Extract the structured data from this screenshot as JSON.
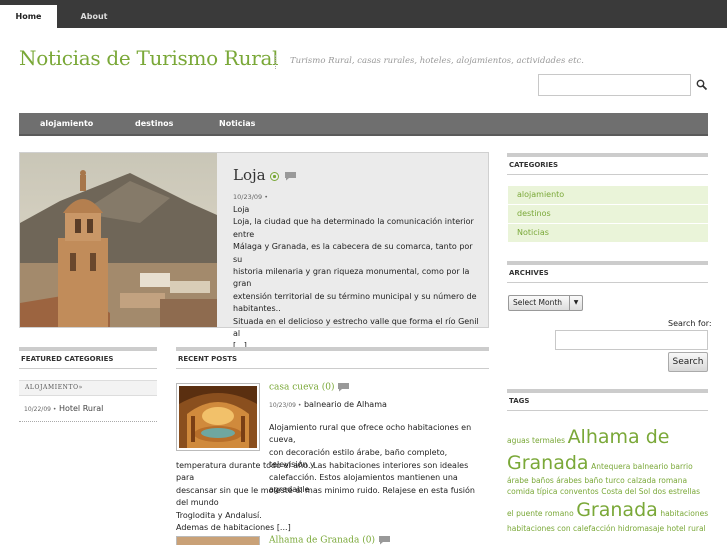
{
  "topnav": {
    "tabs": [
      {
        "label": "Home",
        "active": true
      },
      {
        "label": "About",
        "active": false
      }
    ]
  },
  "header": {
    "title": "Noticias de Turismo Rural",
    "tagline": "Turismo Rural, casas rurales, hoteles, alojamientos, actividades etc.",
    "search_icon": "magnifier-icon"
  },
  "mainnav": {
    "items": [
      "alojamiento",
      "destinos",
      "Noticias"
    ]
  },
  "featured_post": {
    "title": "Loja",
    "date": "10/23/09 •",
    "lines": [
      "Loja",
      "Loja, la ciudad que ha determinado la comunicación interior entre",
      "Málaga y Granada, es la cabecera de su comarca, tanto por su",
      "historia milenaria y gran riqueza monumental, como por la gran",
      "extensión territorial de su término municipal y su número de",
      "habitantes..",
      "Situada en el delicioso y estrecho valle que forma el río Genil al",
      "[...]"
    ]
  },
  "featured_categories": {
    "heading": "FEATURED CATEGORIES",
    "category": "ALOJAMIENTO»",
    "post_date": "10/22/09 •",
    "post_title": "Hotel Rural"
  },
  "recent_posts": {
    "heading": "RECENT POSTS",
    "posts": [
      {
        "title": "casa cueva",
        "comments": "(0)",
        "date": "10/23/09 •",
        "category": "balneario de Alhama",
        "text_a": [
          "Alojamiento rural que ofrece ocho habitaciones en cueva,",
          "con decoración estilo árabe, baño completo, televisión y",
          "calefacción. Estos alojamientos mantienen una agradable"
        ],
        "text_b": [
          "temperatura durante todo el año. Las habitaciones interiores son ideales para",
          "descansar sin que le moleste el mas minimo ruido. Relajese en esta fusión del mundo",
          "Troglodita y Andalusí.",
          "Ademas de habitaciones [...]"
        ]
      },
      {
        "title": "Alhama de Granada",
        "comments": "(0)"
      }
    ]
  },
  "sidebar": {
    "categories_heading": "CATEGORIES",
    "categories": [
      "alojamiento",
      "destinos",
      "Noticias"
    ],
    "archives_heading": "ARCHIVES",
    "archives_select": "Select Month",
    "search_label": "Search for:",
    "search_button": "Search",
    "tags_heading": "TAGS",
    "tags": [
      {
        "text": "aguas termales",
        "size": "s"
      },
      {
        "text": "Alhama de Granada",
        "size": "l"
      },
      {
        "text": "Antequera",
        "size": "s"
      },
      {
        "text": "balneario",
        "size": "s"
      },
      {
        "text": "barrio árabe",
        "size": "s"
      },
      {
        "text": "baños árabes",
        "size": "s"
      },
      {
        "text": "baño turco",
        "size": "s"
      },
      {
        "text": "calzada romana",
        "size": "s"
      },
      {
        "text": "comida típica",
        "size": "s"
      },
      {
        "text": "conventos",
        "size": "s"
      },
      {
        "text": "Costa del Sol",
        "size": "s"
      },
      {
        "text": "dos estrellas",
        "size": "s"
      },
      {
        "text": "el puente romano",
        "size": "s"
      },
      {
        "text": "Granada",
        "size": "l"
      },
      {
        "text": "habitaciones",
        "size": "s"
      },
      {
        "text": "habitaciones con calefacción",
        "size": "s"
      },
      {
        "text": "hidromasaje",
        "size": "s"
      },
      {
        "text": "hotel rural",
        "size": "s"
      }
    ]
  },
  "colors": {
    "accent": "#7aa838",
    "nav_dark": "#3a3a3a",
    "nav_grey": "#6f6f6f",
    "cat_bg": "#eaf4d9"
  }
}
